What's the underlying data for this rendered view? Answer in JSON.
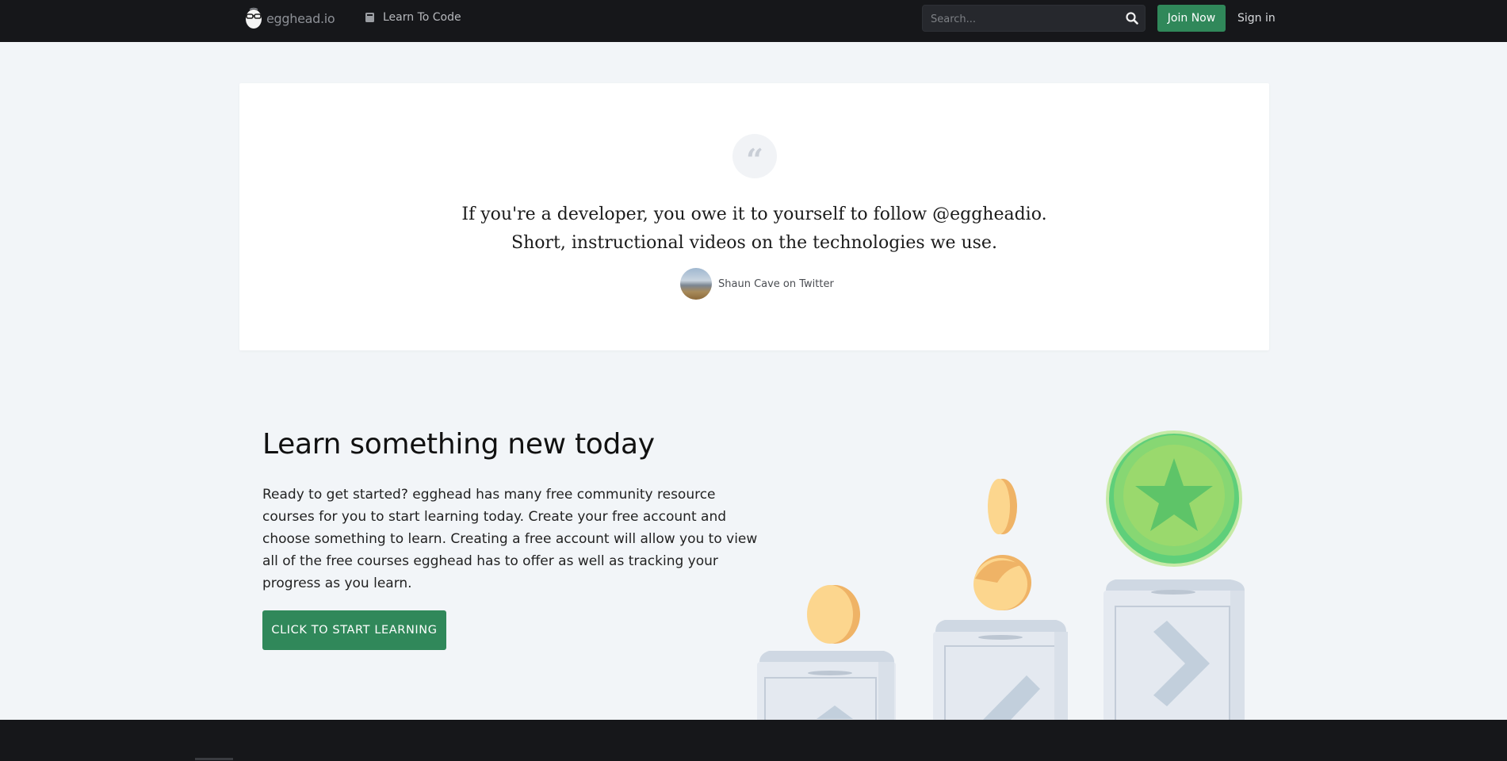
{
  "nav": {
    "logo_text": "egghead.io",
    "learn_label": "Learn To Code",
    "search_placeholder": "Search...",
    "join_label": "Join Now",
    "signin_label": "Sign in"
  },
  "quote": {
    "line1": "If you're a developer, you owe it to yourself to follow @eggheadio.",
    "line2": "Short, instructional videos on the technologies we use.",
    "author": "Shaun Cave on Twitter"
  },
  "learn": {
    "title": "Learn something new today",
    "body": "Ready to get started? egghead has many free community resource courses for you to start learning today. Create your free account and choose something to learn. Creating a free account will allow you to view all of the free courses egghead has to offer as well as tracking your progress as you learn.",
    "cta_label": "CLICK TO START LEARNING"
  },
  "colors": {
    "accent_green": "#30885a",
    "nav_bg": "#16171a",
    "page_bg": "#f2f5f8"
  },
  "icons": [
    "egghead-logo-icon",
    "book-icon",
    "search-icon",
    "quote-icon"
  ]
}
